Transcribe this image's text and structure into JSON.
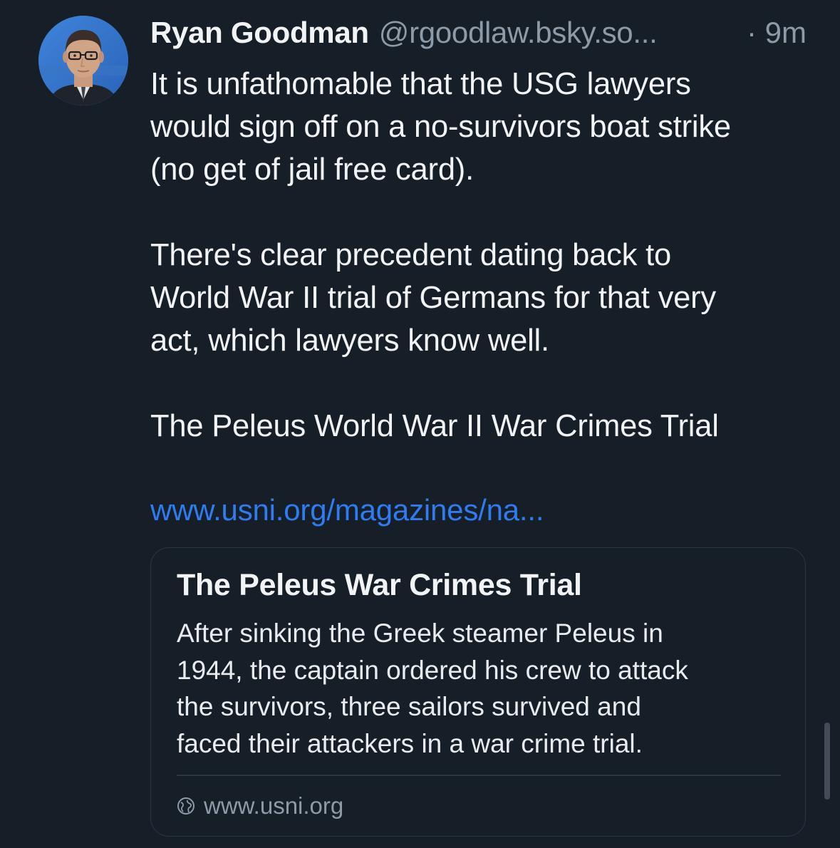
{
  "post": {
    "author": {
      "name": "Ryan Goodman",
      "handle": "@rgoodlaw.bsky.so...",
      "avatar_icon": "user-avatar-photo"
    },
    "timestamp_prefix": "·",
    "timestamp": "9m",
    "body_paragraphs": [
      [
        "It is unfathomable that the USG lawyers",
        "would sign off on a no-survivors boat strike",
        "(no get of jail free card)."
      ],
      [
        "There's clear precedent dating back to",
        "World War II trial of Germans for that very",
        "act, which lawyers know well."
      ],
      [
        "The Peleus World War II War Crimes Trial"
      ]
    ],
    "link_text": "www.usni.org/magazines/na...",
    "link_card": {
      "title": "The Peleus War Crimes Trial",
      "description_lines": [
        "After sinking the Greek steamer Peleus in",
        "1944, the captain ordered his crew to attack",
        "the survivors, three sailors survived and",
        "faced their attackers in a war crime trial."
      ],
      "domain_icon": "globe-icon",
      "domain": "www.usni.org"
    }
  },
  "colors": {
    "background": "#161e28",
    "text_primary": "#f1f3f5",
    "text_secondary": "#8d9aa8",
    "link": "#2f7cf0",
    "card_border": "#2c3643",
    "avatar_ring": "#3a7bd5"
  }
}
